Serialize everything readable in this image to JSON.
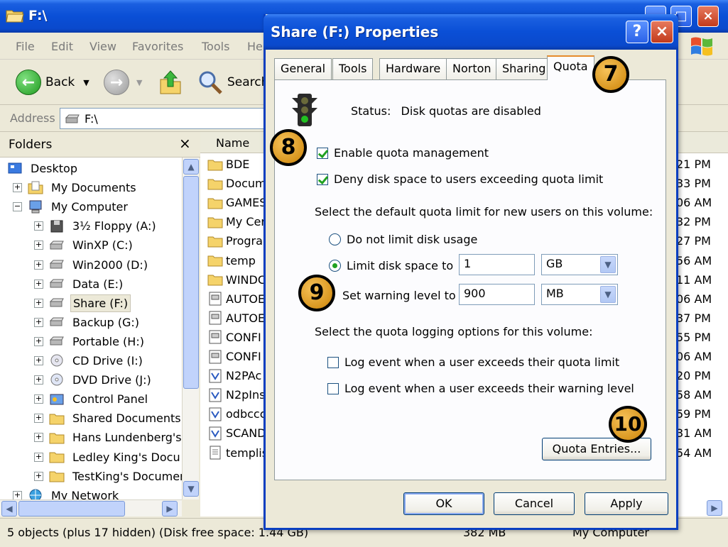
{
  "explorer": {
    "title": "F:\\",
    "menu": [
      "File",
      "Edit",
      "View",
      "Favorites",
      "Tools",
      "He"
    ],
    "toolbar": {
      "back": "Back",
      "search": "Search"
    },
    "address": {
      "label": "Address",
      "value": "F:\\"
    },
    "folders_header": "Folders",
    "folders_close": "×",
    "tree": [
      {
        "label": "Desktop",
        "icon": "desktop-icon",
        "indent": 0
      },
      {
        "label": "My Documents",
        "icon": "my-documents-icon",
        "indent": 1,
        "exp": "+"
      },
      {
        "label": "My Computer",
        "icon": "my-computer-icon",
        "indent": 1,
        "exp": "−"
      },
      {
        "label": "3½ Floppy (A:)",
        "icon": "floppy-icon",
        "indent": 2,
        "exp": "+"
      },
      {
        "label": "WinXP (C:)",
        "icon": "drive-icon",
        "indent": 2,
        "exp": "+"
      },
      {
        "label": "Win2000 (D:)",
        "icon": "drive-icon",
        "indent": 2,
        "exp": "+"
      },
      {
        "label": "Data (E:)",
        "icon": "drive-icon",
        "indent": 2,
        "exp": "+"
      },
      {
        "label": "Share (F:)",
        "icon": "drive-icon",
        "indent": 2,
        "exp": "+",
        "selected": true
      },
      {
        "label": "Backup (G:)",
        "icon": "drive-icon",
        "indent": 2,
        "exp": "+"
      },
      {
        "label": "Portable (H:)",
        "icon": "drive-icon",
        "indent": 2,
        "exp": "+"
      },
      {
        "label": "CD Drive (I:)",
        "icon": "cd-drive-icon",
        "indent": 2,
        "exp": "+"
      },
      {
        "label": "DVD Drive (J:)",
        "icon": "dvd-drive-icon",
        "indent": 2,
        "exp": "+"
      },
      {
        "label": "Control Panel",
        "icon": "control-panel-icon",
        "indent": 2,
        "exp": "+"
      },
      {
        "label": "Shared Documents",
        "icon": "folder-icon",
        "indent": 2,
        "exp": "+"
      },
      {
        "label": "Hans Lundenberg's",
        "icon": "folder-icon",
        "indent": 2,
        "exp": "+"
      },
      {
        "label": "Ledley King's Docu",
        "icon": "folder-icon",
        "indent": 2,
        "exp": "+"
      },
      {
        "label": "TestKing's Documer",
        "icon": "folder-icon",
        "indent": 2,
        "exp": "+"
      },
      {
        "label": "My Network",
        "icon": "network-icon",
        "indent": 1,
        "exp": "+"
      }
    ],
    "file_column": "Name",
    "files": [
      {
        "name": "BDE",
        "icon": "folder-icon"
      },
      {
        "name": "Docum",
        "icon": "folder-icon"
      },
      {
        "name": "GAMES",
        "icon": "folder-icon"
      },
      {
        "name": "My Cer",
        "icon": "folder-icon"
      },
      {
        "name": "Progra",
        "icon": "folder-icon"
      },
      {
        "name": "temp",
        "icon": "folder-icon"
      },
      {
        "name": "WINDC",
        "icon": "folder-icon"
      },
      {
        "name": "AUTOE",
        "icon": "system-file-icon"
      },
      {
        "name": "AUTOE",
        "icon": "system-file-icon"
      },
      {
        "name": "CONFI",
        "icon": "system-file-icon"
      },
      {
        "name": "CONFI",
        "icon": "system-file-icon"
      },
      {
        "name": "N2PAc",
        "icon": "app-file-icon"
      },
      {
        "name": "N2pIns",
        "icon": "app-file-icon"
      },
      {
        "name": "odbccc",
        "icon": "app-file-icon"
      },
      {
        "name": "SCAND",
        "icon": "app-file-icon"
      },
      {
        "name": "templis",
        "icon": "text-file-icon"
      }
    ],
    "times": [
      "21 PM",
      "33 PM",
      "06 AM",
      "32 PM",
      "27 PM",
      "56 AM",
      "11 AM",
      "06 AM",
      "37 PM",
      "55 PM",
      "06 AM",
      "20 PM",
      "58 AM",
      "59 PM",
      "31 AM",
      "54 AM"
    ],
    "status": {
      "objects": "5 objects (plus 17 hidden) (Disk free space: 1.44 GB)",
      "size": "382 MB",
      "location": "My Computer"
    }
  },
  "dialog": {
    "title": "Share (F:) Properties",
    "help": "?",
    "close": "×",
    "tabs": [
      "General",
      "Tools",
      "Hardware",
      "Norton",
      "Sharing",
      "Quota"
    ],
    "active_tab": "Quota",
    "status_label": "Status:",
    "status_value": "Disk quotas are disabled",
    "enable_quota": "Enable quota management",
    "deny_space": "Deny disk space to users exceeding quota limit",
    "default_limit_heading": "Select the default quota limit for new users on this volume:",
    "no_limit": "Do not limit disk usage",
    "limit_to": "Limit disk space to",
    "limit_value": "1",
    "limit_unit": "GB",
    "warning_label": "Set warning level to",
    "warning_value": "900",
    "warning_unit": "MB",
    "logging_heading": "Select the quota logging options for this volume:",
    "log_limit": "Log event when a user exceeds their quota limit",
    "log_warning": "Log event when a user exceeds their warning level",
    "quota_entries": "Quota Entries...",
    "ok": "OK",
    "cancel": "Cancel",
    "apply": "Apply"
  },
  "callouts": [
    "7",
    "8",
    "9",
    "10"
  ],
  "colors": {
    "xp_blue": "#0a4fd6",
    "callout_gold": "#d9961f",
    "check_green": "#21a121"
  }
}
